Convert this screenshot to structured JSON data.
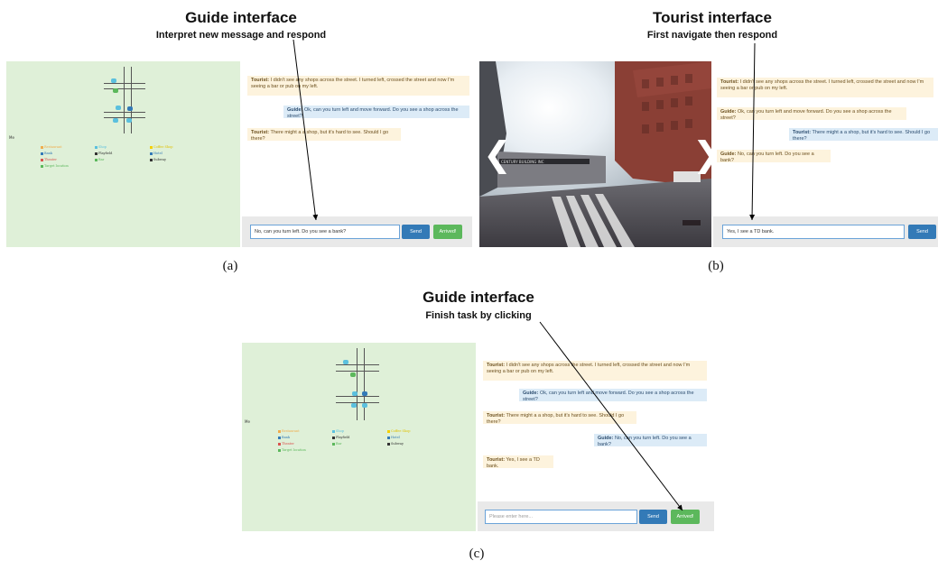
{
  "figure": {
    "panel_a": {
      "title": "Guide interface",
      "subtitle": "Interpret new message and respond",
      "caption": "(a)",
      "map_me_label": "Me",
      "legend": [
        {
          "label": "Restaurant",
          "color": "#f0ad4e"
        },
        {
          "label": "Shop",
          "color": "#5bc0de"
        },
        {
          "label": "Coffee Shop",
          "color": "#f5d000"
        },
        {
          "label": "Bank",
          "color": "#337ab7"
        },
        {
          "label": "Playfield",
          "color": "#333333"
        },
        {
          "label": "Hotel",
          "color": "#337ab7"
        },
        {
          "label": "Theater",
          "color": "#d9534f"
        },
        {
          "label": "Bar",
          "color": "#5cb85c"
        },
        {
          "label": "Subway",
          "color": "#333333"
        },
        {
          "label": "Target location",
          "color": "#5cb85c"
        }
      ],
      "messages": [
        {
          "speaker": "Tourist:",
          "text": " I didn't see any shops across the street. I turned left, crossed the street and now I'm seeing a bar or pub on my left."
        },
        {
          "speaker": "Guide:",
          "text": " Ok, can you turn left and move forward. Do you see a shop across the street?"
        },
        {
          "speaker": "Tourist:",
          "text": " There might a a shop, but it's hard to see. Should I go there?"
        }
      ],
      "input_value": "No, can you turn left. Do you see a bank?",
      "send_label": "Send",
      "arrived_label": "Arrived!"
    },
    "panel_b": {
      "title": "Tourist interface",
      "subtitle": "First navigate then respond",
      "caption": "(b)",
      "left_arrow": "❮",
      "right_arrow": "❯",
      "street_sign": "CENTURY BUILDING INC",
      "messages": [
        {
          "speaker": "Tourist:",
          "text": " I didn't see any shops across the street. I turned left, crossed the street and now I'm seeing a bar or pub on my left."
        },
        {
          "speaker": "Guide:",
          "text": " Ok, can you turn left and move forward. Do you see a shop across the street?"
        },
        {
          "speaker": "Tourist:",
          "text": " There might a a shop, but it's hard to see. Should I go there?"
        },
        {
          "speaker": "Guide:",
          "text": " No, can you turn left. Do you see a bank?"
        }
      ],
      "input_value": "Yes, I see a TD bank.",
      "send_label": "Send"
    },
    "panel_c": {
      "title": "Guide interface",
      "subtitle": "Finish task by clicking",
      "caption": "(c)",
      "map_me_label": "Me",
      "messages": [
        {
          "speaker": "Tourist:",
          "text": " I didn't see any shops across the street. I turned left, crossed the street and now I'm seeing a bar or pub on my left."
        },
        {
          "speaker": "Guide:",
          "text": " Ok, can you turn left and move forward. Do you see a shop across the street?"
        },
        {
          "speaker": "Tourist:",
          "text": " There might a a shop, but it's hard to see. Should I go there?"
        },
        {
          "speaker": "Guide:",
          "text": " No, can you turn left. Do you see a bank?"
        },
        {
          "speaker": "Tourist:",
          "text": " Yes, I see a TD bank."
        }
      ],
      "input_placeholder": "Please enter here...",
      "send_label": "Send",
      "arrived_label": "Arrived!"
    }
  }
}
